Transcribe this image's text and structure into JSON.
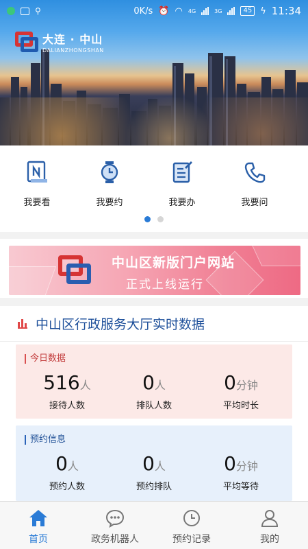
{
  "status_bar": {
    "speed": "0K/s",
    "net_a": "4G",
    "net_b": "3G",
    "battery": "45",
    "time": "11:34"
  },
  "header": {
    "logo_cn": "大连 · 中山",
    "logo_en": "DALIANZHONGSHAN"
  },
  "quick_menu": {
    "items": [
      {
        "label": "我要看",
        "icon": "document-n-icon"
      },
      {
        "label": "我要约",
        "icon": "clock-icon"
      },
      {
        "label": "我要办",
        "icon": "edit-document-icon"
      },
      {
        "label": "我要问",
        "icon": "phone-icon"
      }
    ],
    "page_count": 2,
    "active_page": 0
  },
  "banner": {
    "title": "中山区新版门户网站",
    "subtitle": "正式上线运行"
  },
  "realtime": {
    "title": "中山区行政服务大厅实时数据",
    "today": {
      "tag": "今日数据",
      "stats": [
        {
          "value": "516",
          "unit": "人",
          "label": "接待人数"
        },
        {
          "value": "0",
          "unit": "人",
          "label": "排队人数"
        },
        {
          "value": "0",
          "unit": "分钟",
          "label": "平均时长"
        }
      ]
    },
    "appointment": {
      "tag": "预约信息",
      "stats": [
        {
          "value": "0",
          "unit": "人",
          "label": "预约人数"
        },
        {
          "value": "0",
          "unit": "人",
          "label": "预约排队"
        },
        {
          "value": "0",
          "unit": "分钟",
          "label": "平均等待"
        }
      ]
    }
  },
  "bottom_nav": {
    "items": [
      {
        "label": "首页",
        "icon": "home-icon",
        "active": true
      },
      {
        "label": "政务机器人",
        "icon": "chat-bubble-icon",
        "active": false
      },
      {
        "label": "预约记录",
        "icon": "clock-icon",
        "active": false
      },
      {
        "label": "我的",
        "icon": "user-icon",
        "active": false
      }
    ]
  },
  "colors": {
    "accent": "#2a7bd6",
    "title_blue": "#1d4f9a",
    "today_bg": "#fce9e7",
    "appoint_bg": "#e7f0fb",
    "red": "#d63434"
  }
}
